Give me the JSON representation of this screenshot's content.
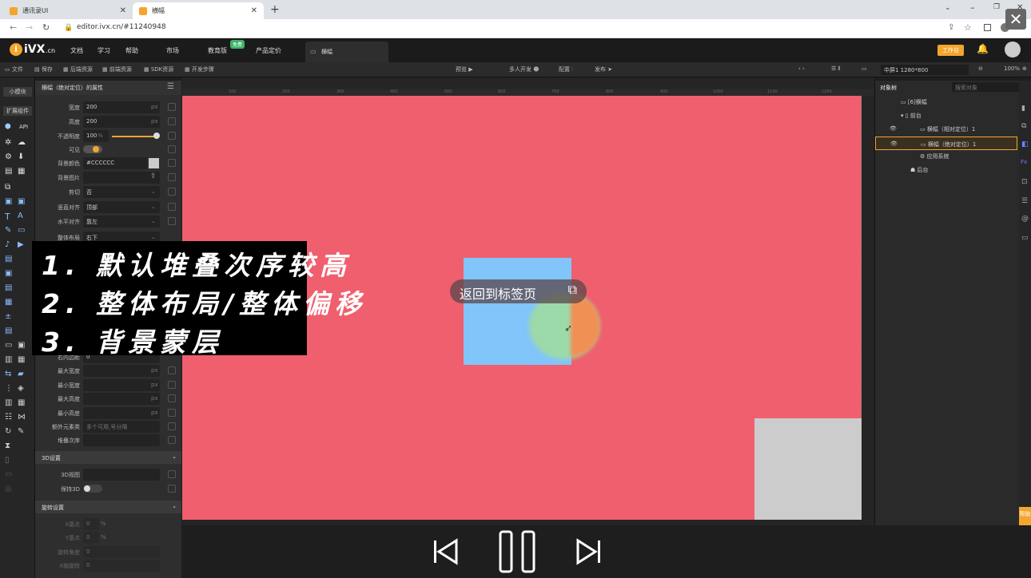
{
  "browser": {
    "tabs": [
      {
        "title": "通讯录UI",
        "active": false
      },
      {
        "title": "横幅",
        "active": true
      }
    ],
    "url": "editor.ivx.cn/#11240948"
  },
  "app": {
    "logo": "iVX",
    "logo_suffix": ".cn",
    "menu": [
      "文档",
      "学习",
      "帮助",
      "市场",
      "教育版",
      "产品定价"
    ],
    "badge": "免费",
    "file_tab": "横幅",
    "workbench": "工作台"
  },
  "toolbar": {
    "items": [
      "文件",
      "保存",
      "后端资源",
      "前端资源",
      "SDK资源",
      "开发步骤"
    ],
    "center": [
      "预览",
      "多人开发",
      "配置",
      "发布"
    ],
    "device": "中屏1 1280*800",
    "zoom": "100%"
  },
  "left_tabs": [
    "小模块",
    "扩展组件"
  ],
  "left_icon_label": "API",
  "props": {
    "header": "横幅（绝对定位）的属性",
    "rows": [
      {
        "label": "宽度",
        "value": "200",
        "unit": "px"
      },
      {
        "label": "高度",
        "value": "200",
        "unit": "px"
      },
      {
        "label": "不透明度",
        "value": "100",
        "unit": "%"
      },
      {
        "label": "可见",
        "value": ""
      },
      {
        "label": "背景颜色",
        "value": "#CCCCCC"
      },
      {
        "label": "背景图片",
        "value": ""
      },
      {
        "label": "剪切",
        "value": "否"
      },
      {
        "label": "竖直对齐",
        "value": "顶部"
      },
      {
        "label": "水平对齐",
        "value": "靠左"
      },
      {
        "label": "整体布局",
        "value": "右下"
      }
    ],
    "lower_rows": [
      {
        "label": "右内边距",
        "value": "0",
        "unit": ""
      },
      {
        "label": "最大宽度",
        "value": "",
        "unit": "px"
      },
      {
        "label": "最小宽度",
        "value": "",
        "unit": "px"
      },
      {
        "label": "最大高度",
        "value": "",
        "unit": "px"
      },
      {
        "label": "最小高度",
        "value": "",
        "unit": "px"
      },
      {
        "label": "额外元素类",
        "value": "多个可用,号分隔",
        "unit": ""
      },
      {
        "label": "堆叠次序",
        "value": "",
        "unit": ""
      }
    ],
    "section_3d": "3D设置",
    "row_3d_view": "3D视图",
    "row_keep3d": "保持3D",
    "section_rotate": "旋转设置",
    "rotate_rows": [
      {
        "label": "X基点",
        "value": "0",
        "unit": "%"
      },
      {
        "label": "Y基点",
        "value": "0",
        "unit": "%"
      },
      {
        "label": "旋转角度",
        "value": "0"
      },
      {
        "label": "X轴旋转",
        "value": "0"
      }
    ]
  },
  "ruler": [
    "100",
    "200",
    "300",
    "400",
    "500",
    "600",
    "700",
    "800",
    "900",
    "1000",
    "1100",
    "1200"
  ],
  "canvas": {
    "bg_color": "#f05f6e",
    "back_to_tab": "返回到标签页"
  },
  "overlay": {
    "lines": [
      "1. 默认堆叠次序较高",
      "2. 整体布局/整体偏移",
      "3. 背景蒙层"
    ]
  },
  "object_tree": {
    "tab": "对象树",
    "search_placeholder": "搜索对象",
    "items": [
      {
        "label": "[6]横幅",
        "level": 0
      },
      {
        "label": "前台",
        "level": 1
      },
      {
        "label": "横幅（相对定位）1",
        "level": 2
      },
      {
        "label": "横幅（绝对定位）1",
        "level": 2,
        "selected": true
      },
      {
        "label": "应用系统",
        "level": 2
      },
      {
        "label": "后台",
        "level": 1
      }
    ]
  },
  "side_help": "帮助"
}
